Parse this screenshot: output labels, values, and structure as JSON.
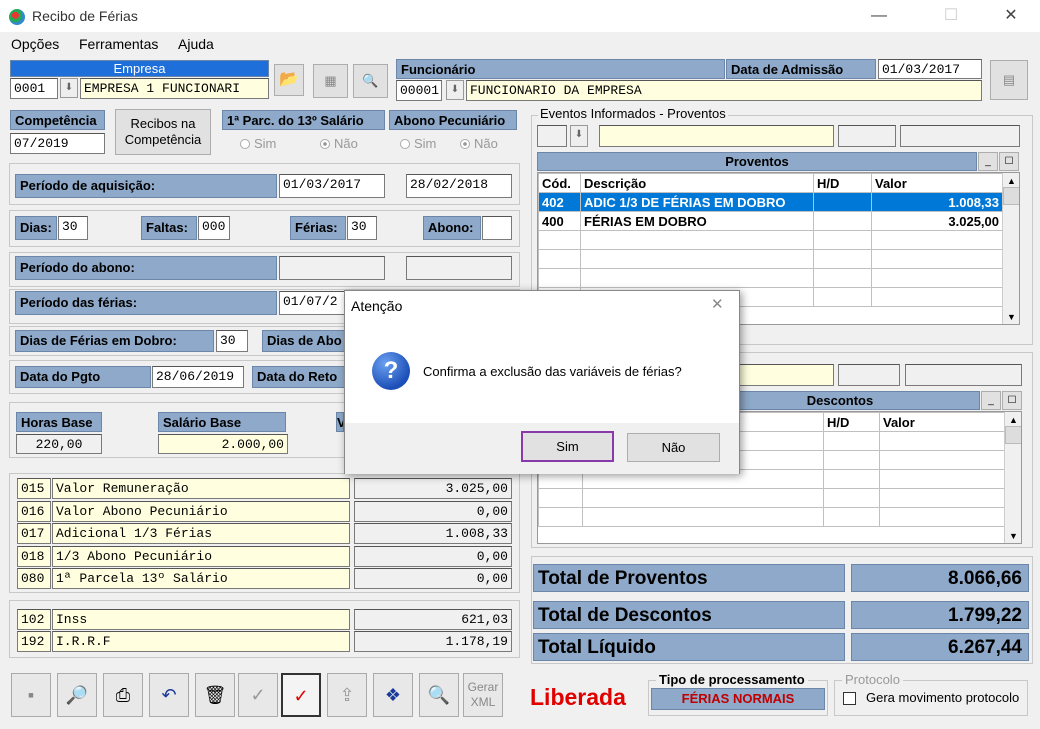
{
  "window": {
    "title": "Recibo de Férias",
    "min": "—",
    "max": "☐",
    "close": "✕"
  },
  "menu": [
    "Opções",
    "Ferramentas",
    "Ajuda"
  ],
  "empresa": {
    "label": "Empresa",
    "code": "0001",
    "name": "EMPRESA 1 FUNCIONARI"
  },
  "funcionario": {
    "label": "Funcionário",
    "code": "00001",
    "name": "FUNCIONARIO DA EMPRESA",
    "admissao_label": "Data de Admissão",
    "admissao": "01/03/2017"
  },
  "competencia": {
    "label": "Competência",
    "value": "07/2019",
    "recibos_btn": "Recibos na Competência"
  },
  "parc13": {
    "label": "1ª Parc. do 13º Salário",
    "sim": "Sim",
    "nao": "Não"
  },
  "abono_pec": {
    "label": "Abono Pecuniário",
    "sim": "Sim",
    "nao": "Não"
  },
  "aquisicao": {
    "label": "Período de aquisição:",
    "inicio": "01/03/2017",
    "fim": "28/02/2018"
  },
  "dias": {
    "dias_label": "Dias:",
    "dias": "30",
    "faltas_label": "Faltas:",
    "faltas": "000",
    "ferias_label": "Férias:",
    "ferias": "30",
    "abono_label": "Abono:",
    "abono": ""
  },
  "periodo_abono": {
    "label": "Período do abono:"
  },
  "periodo_ferias": {
    "label": "Período das férias:",
    "inicio": "01/07/2"
  },
  "dobro": {
    "label": "Dias de Férias em Dobro:",
    "value": "30",
    "abono_label": "Dias de Abo"
  },
  "pgto": {
    "label": "Data do Pgto",
    "value": "28/06/2019",
    "retorno_label": "Data do Reto"
  },
  "base": {
    "horas_label": "Horas Base",
    "horas": "220,00",
    "salario_label": "Salário Base",
    "salario": "2.000,00",
    "cut": "V"
  },
  "rubricas": [
    {
      "cod": "015",
      "desc": "Valor Remuneração",
      "valor": "3.025,00"
    },
    {
      "cod": "016",
      "desc": "Valor Abono Pecuniário",
      "valor": "0,00"
    },
    {
      "cod": "017",
      "desc": "Adicional 1/3 Férias",
      "valor": "1.008,33"
    },
    {
      "cod": "018",
      "desc": "1/3 Abono Pecuniário",
      "valor": "0,00"
    },
    {
      "cod": "080",
      "desc": "1ª Parcela 13º Salário",
      "valor": "0,00"
    }
  ],
  "impostos": [
    {
      "cod": "102",
      "desc": "Inss",
      "valor": "621,03"
    },
    {
      "cod": "192",
      "desc": "I.R.R.F",
      "valor": "1.178,19"
    }
  ],
  "eventos": {
    "label": "Eventos Informados - Proventos"
  },
  "proventos": {
    "title": "Proventos",
    "headers": [
      "Cód.",
      "Descrição",
      "H/D",
      "Valor"
    ],
    "rows": [
      {
        "cod": "402",
        "desc": "ADIC 1/3 DE FÉRIAS EM DOBRO",
        "hd": "",
        "valor": "1.008,33"
      },
      {
        "cod": "400",
        "desc": "FÉRIAS EM DOBRO",
        "hd": "",
        "valor": "3.025,00"
      }
    ]
  },
  "descontos": {
    "title": "Descontos",
    "headers": [
      "H/D",
      "Valor"
    ]
  },
  "totais": {
    "proventos_label": "Total de Proventos",
    "proventos": "8.066,66",
    "descontos_label": "Total de Descontos",
    "descontos": "1.799,22",
    "liquido_label": "Total Líquido",
    "liquido": "6.267,44"
  },
  "toolbar": {
    "gerar_xml": "Gerar XML"
  },
  "status": {
    "text": "Liberada",
    "color": "#e00000"
  },
  "processamento": {
    "label": "Tipo de processamento",
    "value": "FÉRIAS NORMAIS"
  },
  "protocolo": {
    "label": "Protocolo",
    "check": "Gera movimento protocolo"
  },
  "dialog": {
    "title": "Atenção",
    "message": "Confirma a exclusão das variáveis de férias?",
    "yes": "Sim",
    "no": "Não",
    "close": "✕",
    "icon": "?"
  }
}
